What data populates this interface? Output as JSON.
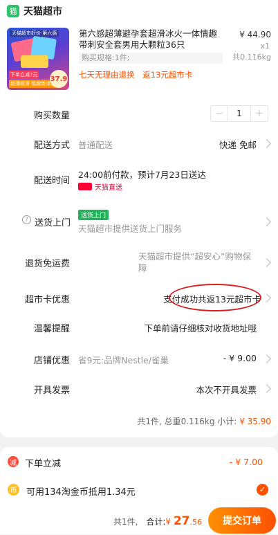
{
  "store": {
    "name": "天猫超市",
    "logo_icon": "tmall-supermarket-logo-icon"
  },
  "product": {
    "title": "第六感超薄避孕套超滑冰火一体情趣带刺安全套男用大颗粒36只",
    "price": "¥ 44.90",
    "qty": "x1",
    "weight": "共0.116kg",
    "spec": "购买规格:1件;",
    "tags": [
      "七天无理由退换",
      "返13元超市卡"
    ],
    "thumb": {
      "top_tag": "天猫超市好价·第六感",
      "promo1": "下单立减7元",
      "promo2": "超薄顺滑 情趣新体验",
      "price_tag": "37.9"
    }
  },
  "rows": {
    "quantity": {
      "label": "购买数量",
      "value": "1",
      "minus": "−",
      "plus": "+"
    },
    "delivery": {
      "label": "配送方式",
      "left_value": "普通配送",
      "right_value": "快递 免邮"
    },
    "time": {
      "label": "配送时间",
      "value": "24:00前付款，预计7月23日送达",
      "badge": "天猫直送"
    },
    "door": {
      "label": "送货上门",
      "badge": "送货上门",
      "value": "天猫超市提供送货上门服务"
    },
    "return": {
      "label": "退货免运费",
      "value": "天猫超市提供“超安心”购物保障"
    },
    "card": {
      "label": "超市卡优惠",
      "value": "支付成功共返13元超市卡"
    },
    "tip": {
      "label": "温馨提醒",
      "value": "下单前请仔细核对收货地址哦"
    },
    "shop": {
      "label": "店铺优惠",
      "left_value": "省9元:品牌Nestle/雀巢",
      "right_value": "- ¥ 9.00"
    },
    "invoice": {
      "label": "开具发票",
      "value": "本次不开具发票"
    }
  },
  "subtotal": {
    "text": "共1件, 总重0.116kg 小计:",
    "amount": "¥ 35.90"
  },
  "bottom": {
    "discount": {
      "label": "下单立减",
      "value": "- ¥ 7.00",
      "icon_text": "减"
    },
    "coins": {
      "label": "可用134淘金币抵用1.34元",
      "icon_text": "币"
    },
    "total": {
      "count": "共1件,",
      "label": "合计:",
      "currency": "¥",
      "big": "27",
      "small": ".56"
    },
    "submit_label": "提交订单"
  },
  "colors": {
    "accent": "#ff5000",
    "tmall_red": "#ff0036",
    "green": "#21b35a",
    "annotation_red": "#d81e1e"
  }
}
